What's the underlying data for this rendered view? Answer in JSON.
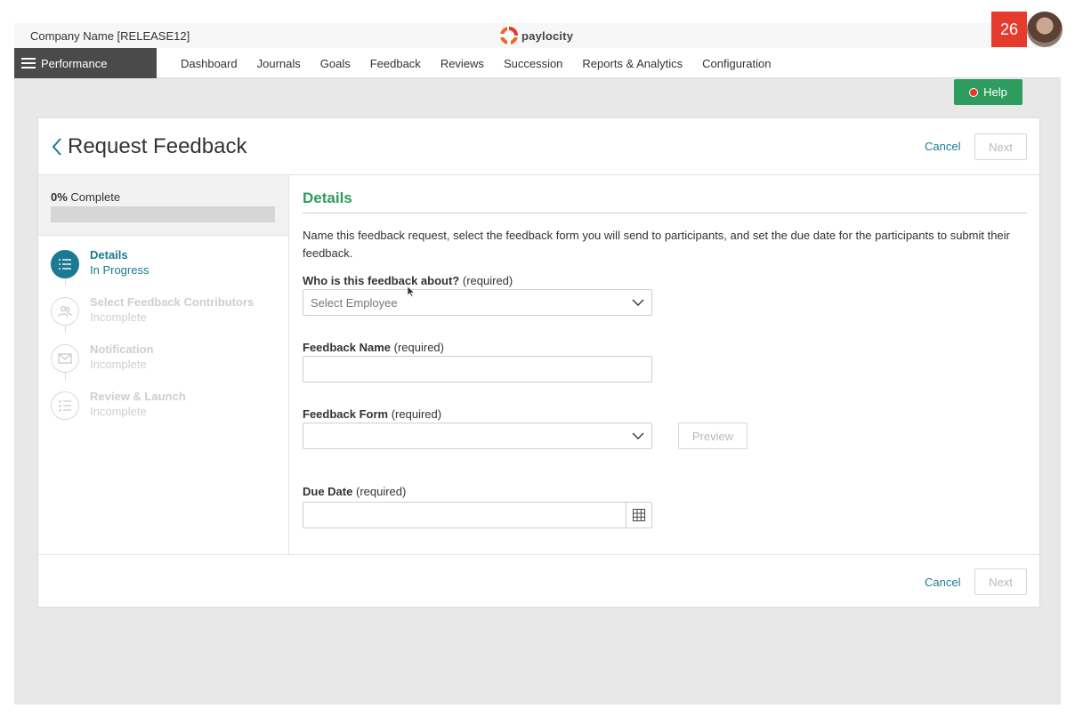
{
  "header": {
    "company_name": "Company Name [RELEASE12]",
    "logo_text": "paylocity",
    "notification_count": "26"
  },
  "nav": {
    "module_label": "Performance",
    "items": [
      {
        "label": "Dashboard"
      },
      {
        "label": "Journals"
      },
      {
        "label": "Goals"
      },
      {
        "label": "Feedback"
      },
      {
        "label": "Reviews"
      },
      {
        "label": "Succession"
      },
      {
        "label": "Reports & Analytics"
      },
      {
        "label": "Configuration"
      }
    ]
  },
  "help": {
    "label": "Help"
  },
  "page": {
    "title": "Request Feedback",
    "cancel_label": "Cancel",
    "next_label": "Next"
  },
  "progress": {
    "percent_label": "0%",
    "complete_label": "Complete",
    "value": 0
  },
  "steps": [
    {
      "title": "Details",
      "status": "In Progress",
      "icon": "list-icon",
      "active": true
    },
    {
      "title": "Select Feedback Contributors",
      "status": "Incomplete",
      "icon": "people-icon",
      "active": false
    },
    {
      "title": "Notification",
      "status": "Incomplete",
      "icon": "envelope-icon",
      "active": false
    },
    {
      "title": "Review & Launch",
      "status": "Incomplete",
      "icon": "checklist-icon",
      "active": false
    }
  ],
  "details": {
    "section_title": "Details",
    "description": "Name this feedback request, select the feedback form you will send to participants, and set the due date for the participants to submit their feedback.",
    "about": {
      "label": "Who is this feedback about?",
      "required": "(required)",
      "placeholder": "Select Employee"
    },
    "name": {
      "label": "Feedback Name",
      "required": "(required)",
      "value": ""
    },
    "form": {
      "label": "Feedback Form",
      "required": "(required)",
      "value": "",
      "preview_label": "Preview"
    },
    "due": {
      "label": "Due Date",
      "required": "(required)",
      "value": ""
    }
  },
  "colors": {
    "accent": "#1a7a91",
    "section_green": "#2e9c5e",
    "notification_red": "#e43b2c",
    "module_dark": "#4a4a4a"
  }
}
